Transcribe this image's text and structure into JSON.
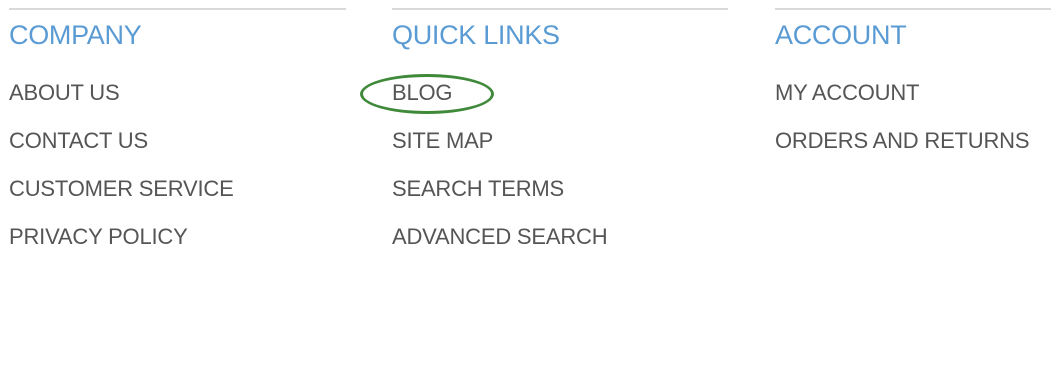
{
  "colors": {
    "heading": "#5a9bd4",
    "link": "#555555",
    "divider": "#d9d9d9",
    "highlight_ring": "#3f8a3a",
    "background": "#ffffff"
  },
  "footer": {
    "columns": [
      {
        "title": "COMPANY",
        "links": [
          "ABOUT US",
          "CONTACT US",
          "CUSTOMER SERVICE",
          "PRIVACY POLICY"
        ]
      },
      {
        "title": "QUICK LINKS",
        "links": [
          "BLOG",
          "SITE MAP",
          "SEARCH TERMS",
          "ADVANCED SEARCH"
        ],
        "highlighted_link": "BLOG"
      },
      {
        "title": "ACCOUNT",
        "links": [
          "MY ACCOUNT",
          "ORDERS AND RETURNS"
        ]
      }
    ]
  }
}
